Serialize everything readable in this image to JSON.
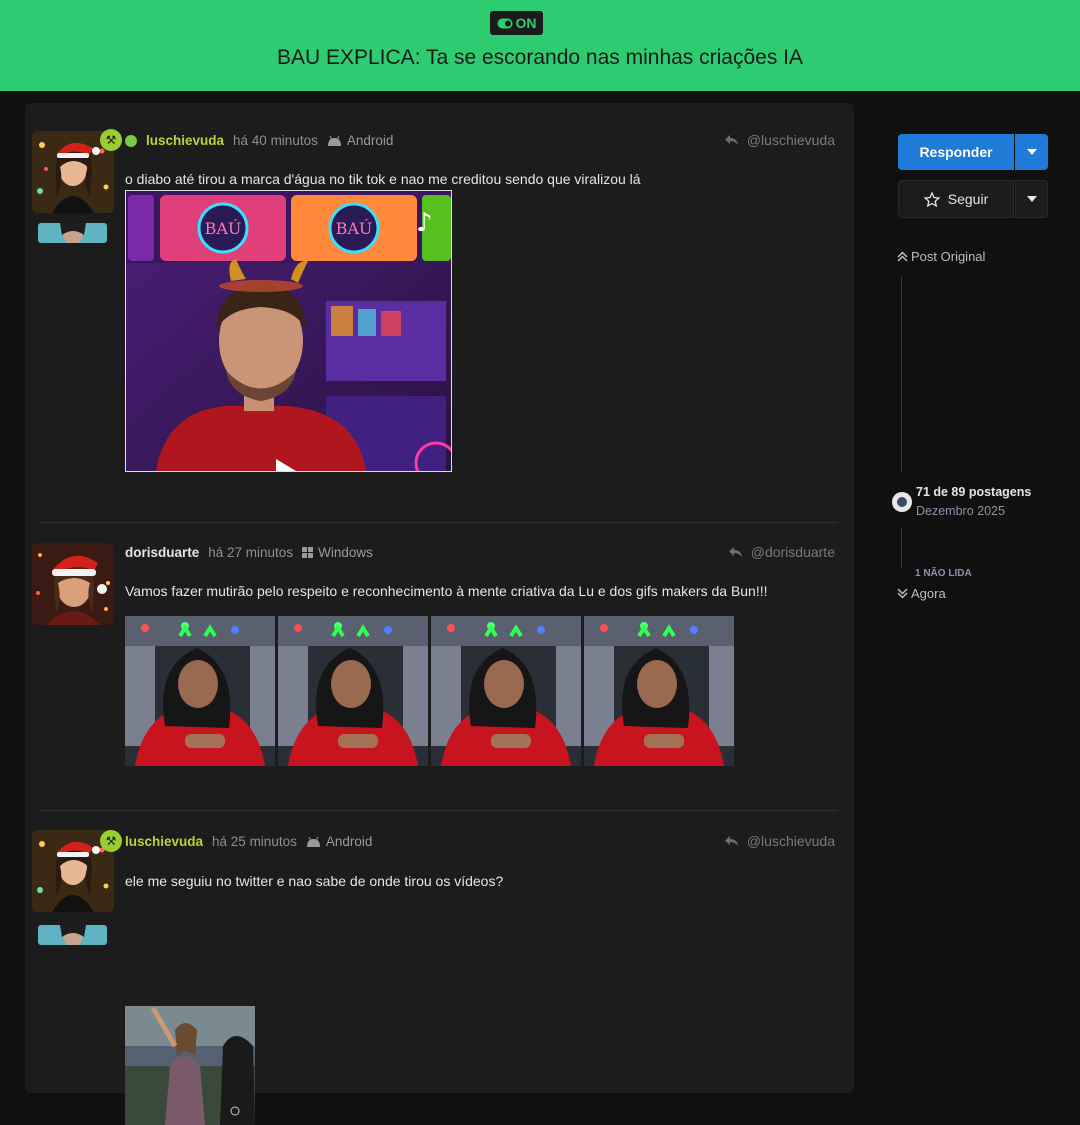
{
  "banner": {
    "badge_label": "ON",
    "title": "BAU EXPLICA: Ta se escorando nas minhas criações IA",
    "bg_color": "#2ecc71"
  },
  "posts": [
    {
      "username": "luschievuda",
      "time": "há 40 minutos",
      "device": "Android",
      "device_icon": "android-icon",
      "reply_to": "@luschievuda",
      "text": "o diabo até tirou a marca d'água no tik tok e nao me creditou sendo que viralizou lá"
    },
    {
      "username": "dorisduarte",
      "time": "há 27 minutos",
      "device": "Windows",
      "device_icon": "windows-icon",
      "reply_to": "@dorisduarte",
      "text": "Vamos fazer mutirão pelo respeito e reconhecimento à mente criativa da Lu e dos gifs makers da Bun!!!"
    },
    {
      "username": "luschievuda",
      "time": "há 25 minutos",
      "device": "Android",
      "device_icon": "android-icon",
      "reply_to": "@luschievuda",
      "text": "ele me seguiu no twitter e nao sabe de onde tirou os vídeos?"
    }
  ],
  "sidebar": {
    "reply_button": "Responder",
    "follow_button": "Seguir",
    "original_post": "Post Original",
    "progress_text": "71 de 89 postagens",
    "progress_date": "Dezembro 2025",
    "unread": "1 NÃO LIDA",
    "now": "Agora",
    "accent_color": "#1f7ad8"
  }
}
